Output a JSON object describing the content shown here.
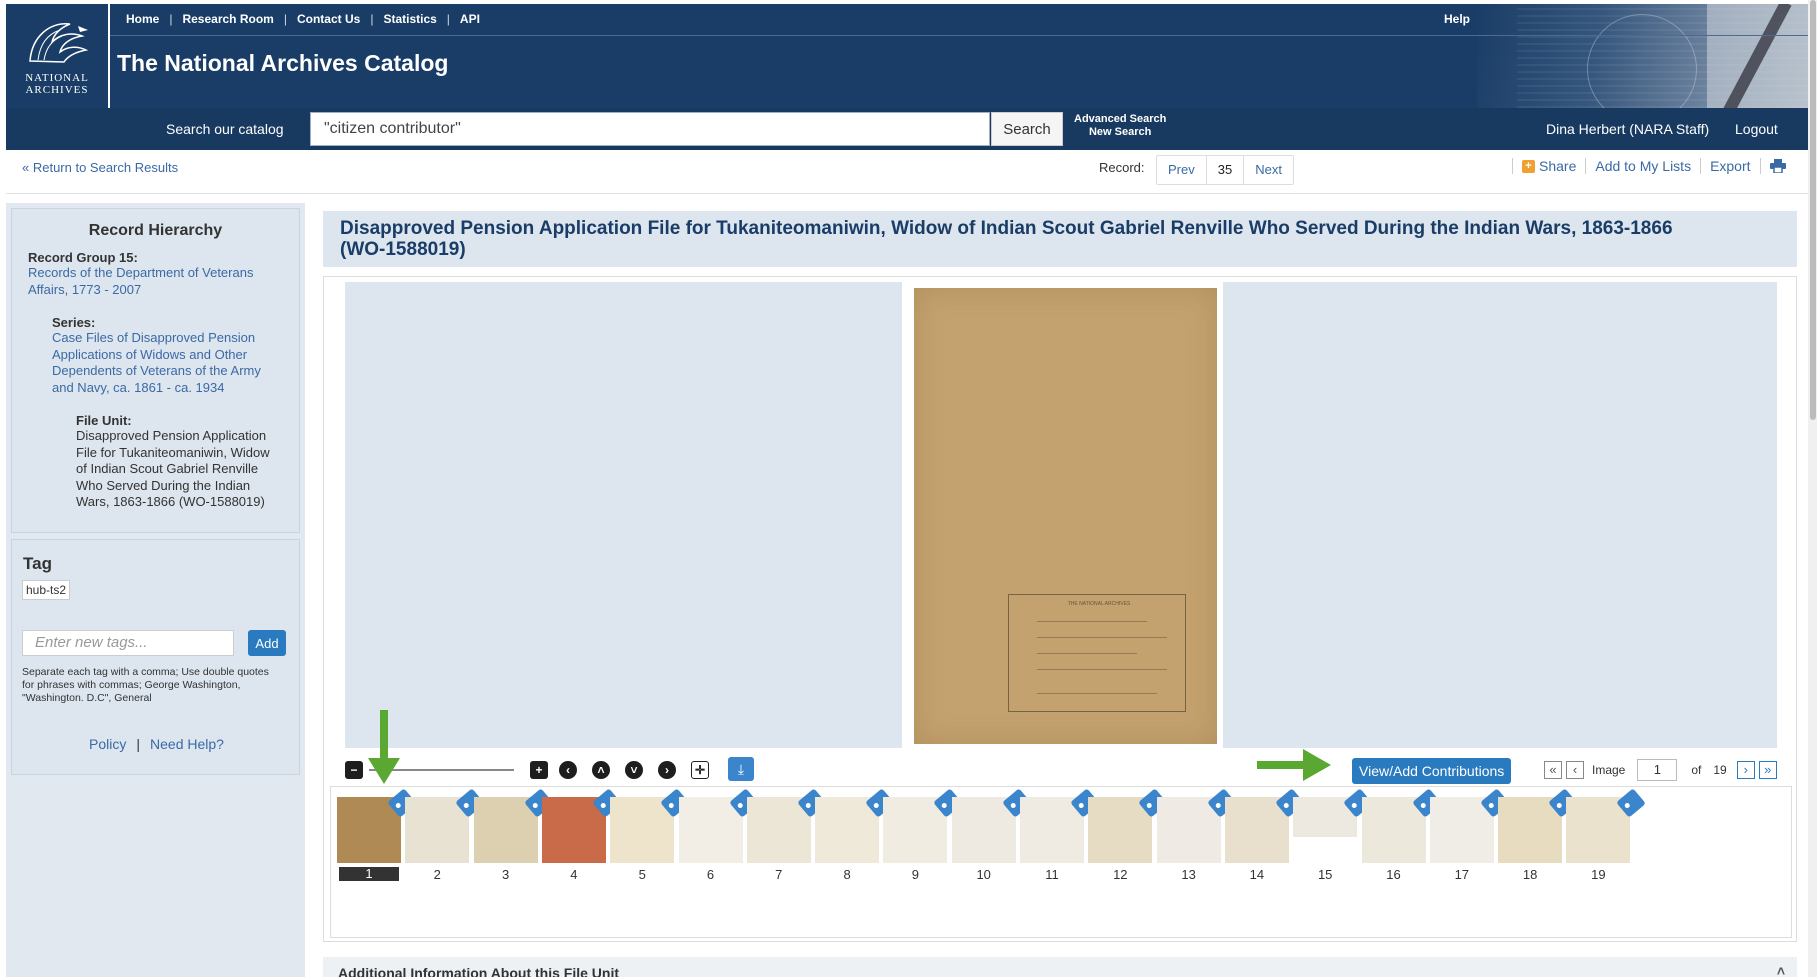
{
  "header": {
    "logo": {
      "line1": "NATIONAL",
      "line2": "ARCHIVES"
    },
    "nav": [
      "Home",
      "Research Room",
      "Contact Us",
      "Statistics",
      "API"
    ],
    "help": "Help",
    "title": "The National Archives Catalog"
  },
  "search": {
    "label": "Search our catalog",
    "value": "\"citizen contributor\"",
    "button": "Search",
    "advanced": "Advanced Search",
    "new_search": "New Search",
    "user": "Dina Herbert (NARA Staff)",
    "logout": "Logout"
  },
  "record_nav": {
    "return": "« Return to Search Results",
    "record_label": "Record:",
    "prev": "Prev",
    "number": "35",
    "next": "Next",
    "share": "Share",
    "add_to_lists": "Add to My Lists",
    "export": "Export"
  },
  "hierarchy": {
    "title": "Record Hierarchy",
    "record_group_label": "Record Group 15:",
    "record_group_lines": [
      "Records of the Department of Veterans",
      "Affairs, 1773 - 2007"
    ],
    "series_label": "Series:",
    "series_lines": [
      "Case Files of Disapproved Pension",
      "Applications of Widows and Other",
      "Dependents of Veterans of the Army",
      "and Navy, ca. 1861 - ca. 1934"
    ],
    "file_unit_label": "File Unit:",
    "file_unit_lines": [
      "Disapproved Pension Application",
      "File for Tukaniteomaniwin, Widow",
      "of Indian Scout Gabriel Renville",
      "Who Served During the Indian",
      "Wars, 1863-1866 (WO-1588019)"
    ]
  },
  "tag_panel": {
    "title": "Tag",
    "existing_tag": "hub-ts2",
    "placeholder": "Enter new tags...",
    "add": "Add",
    "help_lines": [
      "Separate each tag with a comma; Use double quotes",
      "for phrases with commas; George Washington,",
      "\"Washington. D.C\", General"
    ],
    "policy": "Policy",
    "need_help": "Need Help?"
  },
  "record": {
    "title_line1": "Disapproved Pension Application File for Tukaniteomaniwin, Widow of Indian Scout Gabriel Renville Who Served During the Indian Wars, 1863-1866",
    "title_line2": "(WO-1588019)"
  },
  "viewer": {
    "contributions_button": "View/Add Contributions",
    "image_label": "Image",
    "image_current": "1",
    "of_label": "of",
    "image_total": "19",
    "thumbnails": [
      "1",
      "2",
      "3",
      "4",
      "5",
      "6",
      "7",
      "8",
      "9",
      "10",
      "11",
      "12",
      "13",
      "14",
      "15",
      "16",
      "17",
      "18",
      "19"
    ],
    "active_thumbnail": "1"
  },
  "additional": {
    "title": "Additional Information About this File Unit"
  },
  "icons": {
    "zoom_out": "minus-square-icon",
    "zoom_in": "plus-square-icon",
    "rotate_left": "arrow-left-circle-icon",
    "up": "arrow-up-circle-icon",
    "down": "arrow-down-circle-icon",
    "rotate_right": "arrow-right-circle-icon",
    "fit": "fit-screen-icon",
    "download": "download-icon",
    "print": "print-icon",
    "tag": "tag-icon"
  },
  "colors": {
    "header": "#1a3d67",
    "link": "#3a6aa5",
    "button": "#2a7ac0",
    "annotation_arrow": "#5aa832",
    "panel": "#dde5ee"
  }
}
